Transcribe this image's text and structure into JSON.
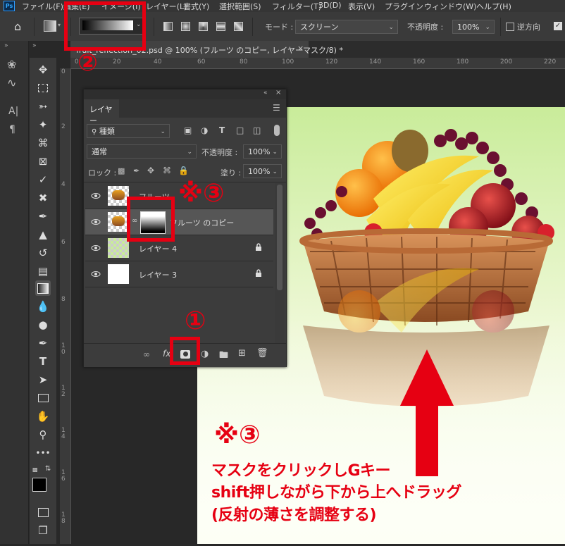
{
  "app": {
    "logo": "Ps"
  },
  "menu": [
    "ファイル(F)",
    "編集(E)",
    "イメージ(I)",
    "レイヤー(L)",
    "書式(Y)",
    "選択範囲(S)",
    "フィルター(T)",
    "3D(D)",
    "表示(V)",
    "プラグイン",
    "ウィンドウ(W)",
    "ヘルプ(H)"
  ],
  "options": {
    "mode_label": "モード :",
    "mode_value": "スクリーン",
    "opacity_label": "不透明度 :",
    "opacity_value": "100%",
    "reverse_label": "逆方向"
  },
  "document_tab": {
    "title": "fruit_reflection_02.psd @ 100% (フルーツ のコピー, レイヤーマスク/8) *",
    "close": "×"
  },
  "rulers": {
    "top": [
      "0",
      "20",
      "40",
      "60",
      "80",
      "100",
      "120",
      "140",
      "160",
      "180",
      "200",
      "220",
      "240"
    ],
    "left": [
      "0",
      "2",
      "4",
      "6",
      "8",
      "1\n0",
      "1\n2",
      "1\n4",
      "1\n6",
      "1\n8",
      "2\n0"
    ]
  },
  "layers_panel": {
    "tab": "レイヤー",
    "filter_label": "種類",
    "blend_mode": "通常",
    "opacity_label": "不透明度 :",
    "opacity_value": "100%",
    "lock_label": "ロック :",
    "fill_label": "塗り :",
    "fill_value": "100%",
    "layers": [
      {
        "name": "フルーツ",
        "locked": false
      },
      {
        "name": "フルーツ のコピー",
        "locked": false,
        "has_mask": true
      },
      {
        "name": "レイヤー 4",
        "locked": true
      },
      {
        "name": "レイヤー 3",
        "locked": true
      }
    ],
    "footer_fx": "fx"
  },
  "annotations": {
    "num1": "①",
    "num2": "②",
    "num3_mask": "※③",
    "num3_text": "※③",
    "line1": "マスクをクリックしGキー",
    "line2": "shift押しながら下から上へドラッグ",
    "line3": "(反射の薄さを調整する)"
  },
  "colors": {
    "annotation_red": "#e60012",
    "panel_bg": "#3c3c3c",
    "ui_bg": "#282828"
  }
}
